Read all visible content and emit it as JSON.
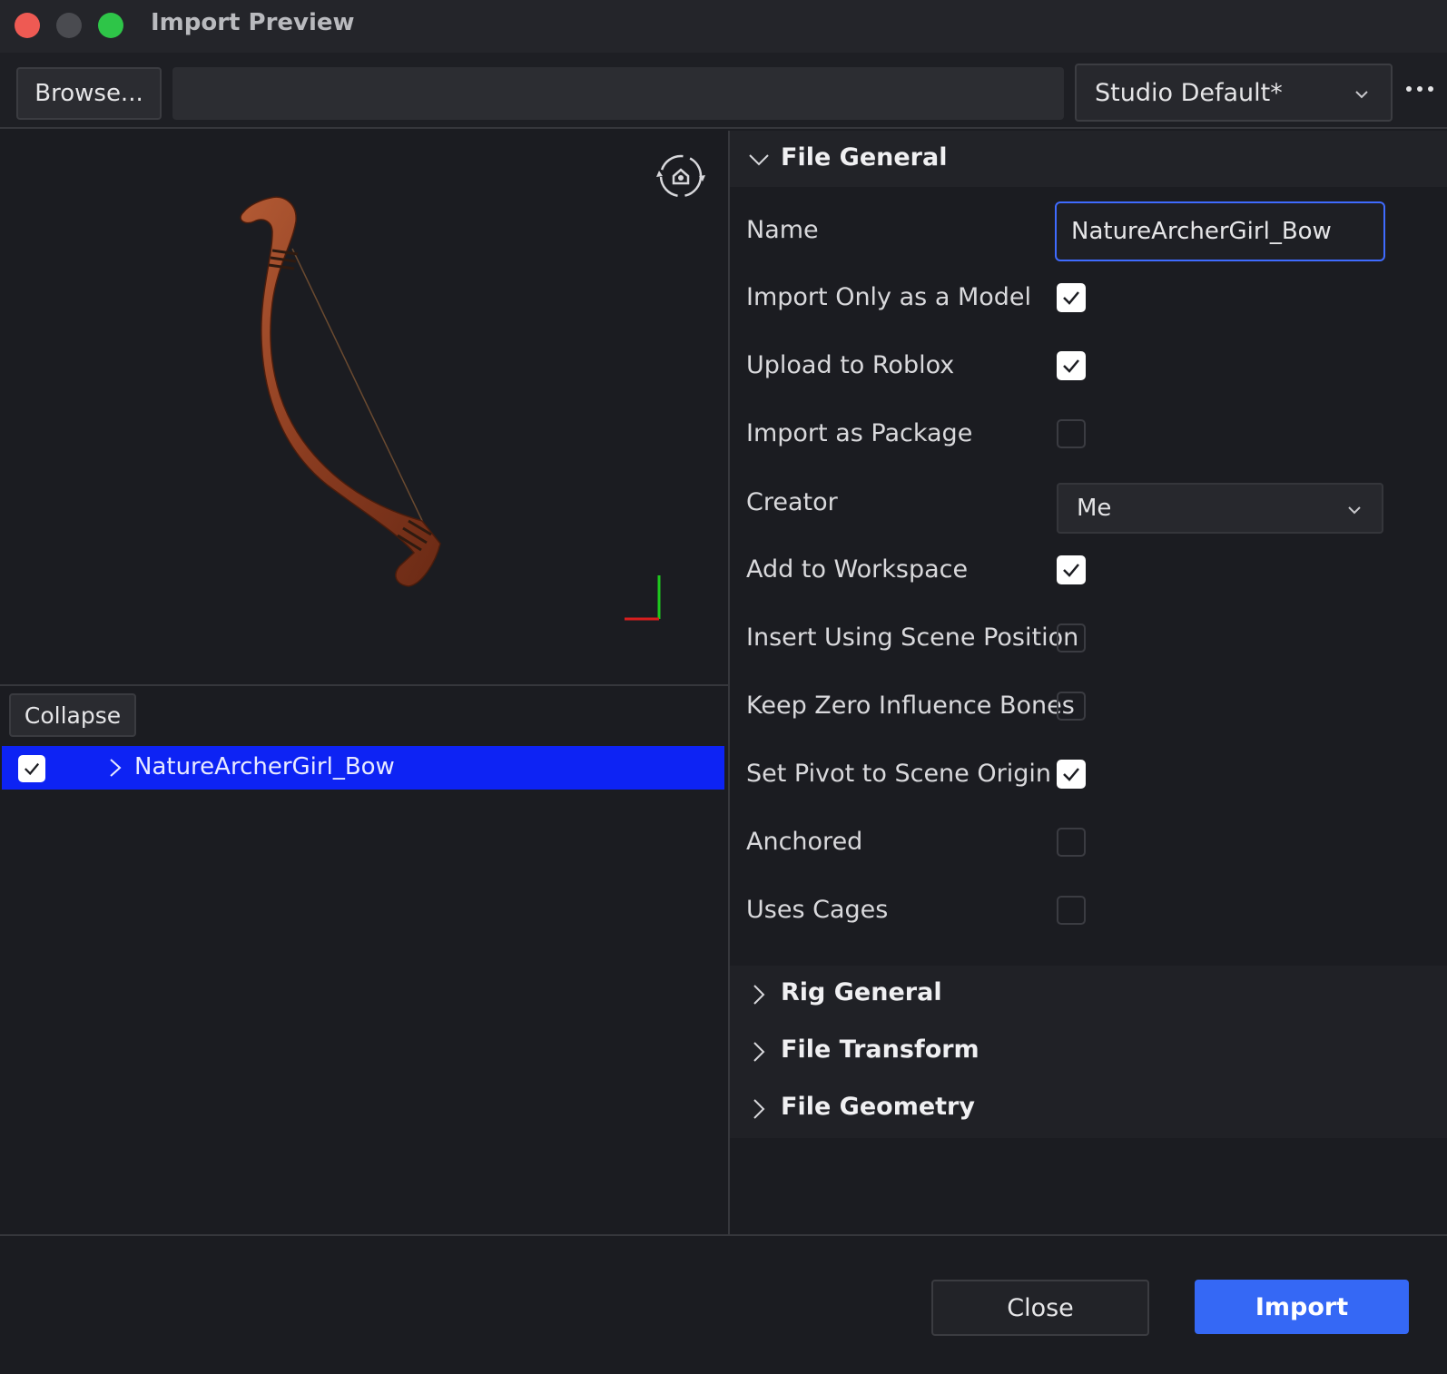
{
  "window": {
    "title": "Import Preview"
  },
  "toolbar": {
    "browse_label": "Browse...",
    "path_value": "",
    "preset": "Studio Default*"
  },
  "tree": {
    "collapse_label": "Collapse",
    "items": [
      {
        "label": "NatureArcherGirl_Bow",
        "checked": true,
        "selected": true
      }
    ]
  },
  "sections": {
    "file_general": "File General",
    "rig_general": "Rig General",
    "file_transform": "File Transform",
    "file_geometry": "File Geometry"
  },
  "file_general": {
    "name_label": "Name",
    "name_value": "NatureArcherGirl_Bow",
    "creator_label": "Creator",
    "creator_value": "Me",
    "checkboxes": [
      {
        "label": "Import Only as a Model",
        "checked": true
      },
      {
        "label": "Upload to Roblox",
        "checked": true
      },
      {
        "label": "Import as Package",
        "checked": false
      },
      {
        "label": "Add to Workspace",
        "checked": true
      },
      {
        "label": "Insert Using Scene Position",
        "checked": false
      },
      {
        "label": "Keep Zero Influence Bones",
        "checked": false
      },
      {
        "label": "Set Pivot to Scene Origin",
        "checked": true
      },
      {
        "label": "Anchored",
        "checked": false
      },
      {
        "label": "Uses Cages",
        "checked": false
      }
    ]
  },
  "footer": {
    "close_label": "Close",
    "import_label": "Import"
  },
  "colors": {
    "accent": "#3568f5",
    "selection": "#0d23f4",
    "background": "#1b1c21"
  }
}
